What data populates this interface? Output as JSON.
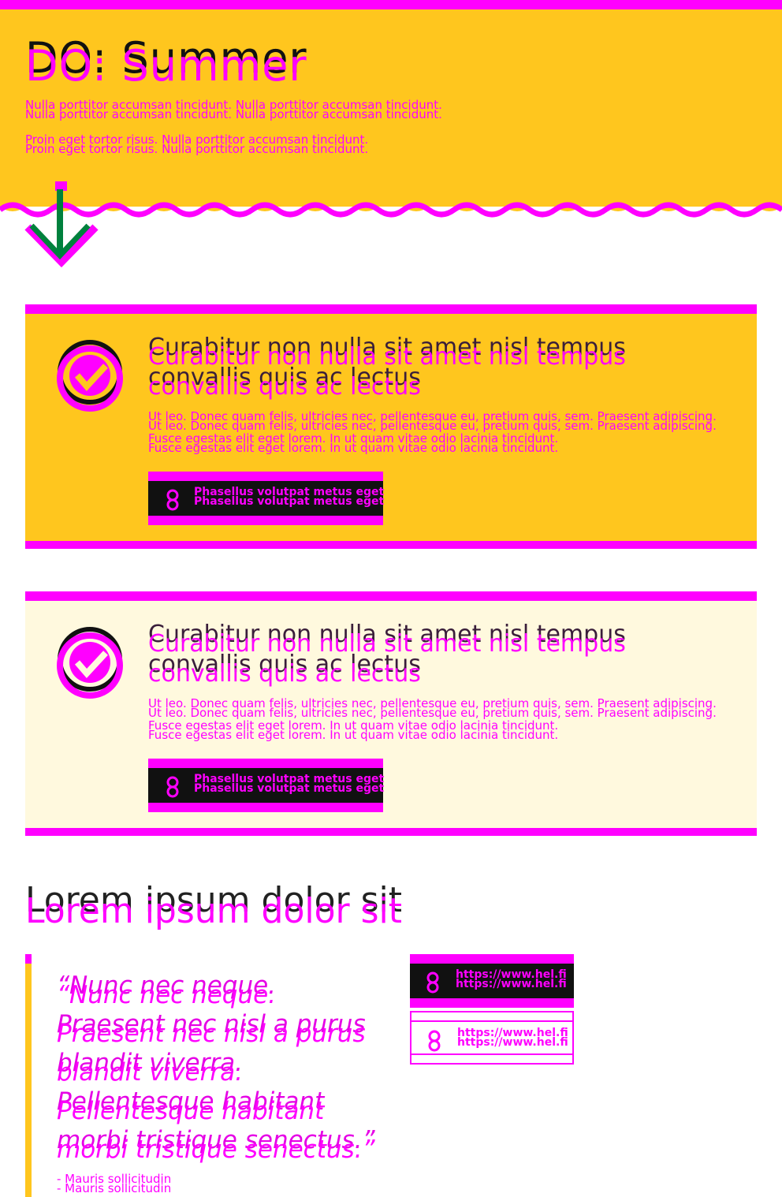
{
  "hero": {
    "title": "DO: Summer",
    "lead1": "Nulla porttitor accumsan tincidunt. Nulla porttitor accumsan tincidunt.",
    "lead2": "Proin eget tortor risus. Nulla porttitor accumsan tincidunt."
  },
  "cards": [
    {
      "title": "Curabitur non nulla sit amet nisl tempus convallis quis ac lectus",
      "body": "Ut leo. Donec quam felis, ultricies nec, pellentesque eu, pretium quis, sem. Praesent adipiscing. Fusce egestas elit eget lorem. In ut quam vitae odio lacinia tincidunt.",
      "button": "Phasellus volutpat metus eget"
    },
    {
      "title": "Curabitur non nulla sit amet nisl tempus convallis quis ac lectus",
      "body": "Ut leo. Donec quam felis, ultricies nec, pellentesque eu, pretium quis, sem. Praesent adipiscing. Fusce egestas elit eget lorem. In ut quam vitae odio lacinia tincidunt.",
      "button": "Phasellus volutpat metus eget"
    }
  ],
  "section": {
    "heading": "Lorem ipsum dolor sit",
    "quote": "“Nunc nec neque. Praesent nec nisl a purus blandit viverra. Pellentesque habitant morbi tristique senectus.”",
    "cite": "- Mauris sollicitudin",
    "links": [
      "https://www.hel.fi",
      "https://www.hel.fi"
    ]
  },
  "colors": {
    "accent": "#ff00ff",
    "yellow": "#ffc61e",
    "pale": "#fff9de",
    "dark": "#111111",
    "arrow": "#00813d"
  }
}
